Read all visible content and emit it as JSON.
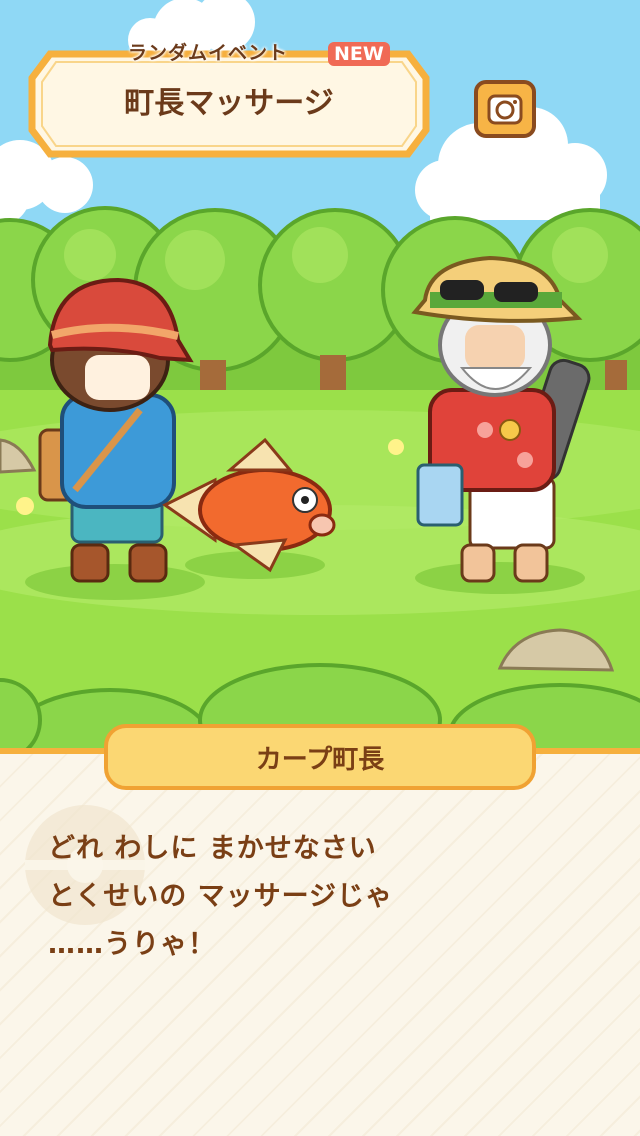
{
  "event": {
    "tag": "ランダムイベント",
    "new_badge": "NEW",
    "title": "町長マッサージ"
  },
  "camera_icon": "camera-icon",
  "dialog": {
    "speaker": "カープ町長",
    "lines": [
      "どれ わしに まかせなさい",
      "とくせいの マッサージじゃ",
      "……うりゃ！"
    ]
  },
  "colors": {
    "sky": "#8fd8f5",
    "grass": "#9be04a",
    "banner_border": "#f6b03e",
    "text_brown": "#7a3f15",
    "dialog_bg": "#fbf6ea"
  }
}
